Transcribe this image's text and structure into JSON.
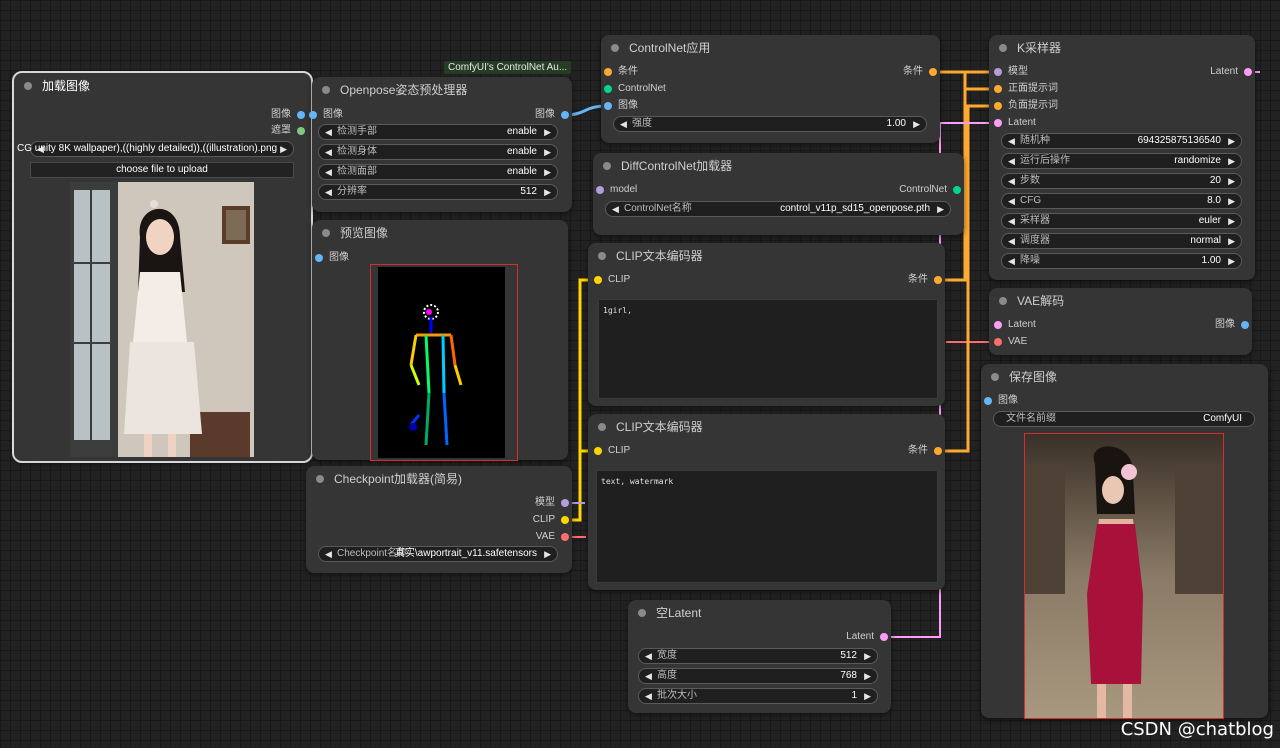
{
  "colors": {
    "image": "#64b5f6",
    "mask": "#81c784",
    "conditioning": "#ffa931",
    "control_net": "#00d78d",
    "model": "#b39ddb",
    "clip": "#ffd500",
    "vae": "#ff6e6e",
    "latent": "#ff9cf9",
    "frame_red": "#d32f2f"
  },
  "badge": "ComfyUI's ControlNet Au...",
  "load_image": {
    "title": "加载图像",
    "outputs": [
      "图像",
      "遮罩"
    ],
    "file_value": "CG unity 8K wallpaper),((highly detailed)),((illustration).png",
    "upload_label": "choose file to upload",
    "image_icon": "photo-girl-white-dress"
  },
  "openpose": {
    "title": "Openpose姿态预处理器",
    "input": "图像",
    "output": "图像",
    "widgets": [
      {
        "name": "检测手部",
        "value": "enable"
      },
      {
        "name": "检测身体",
        "value": "enable"
      },
      {
        "name": "检测面部",
        "value": "enable"
      },
      {
        "name": "分辨率",
        "value": "512"
      }
    ]
  },
  "preview": {
    "title": "预览图像",
    "input": "图像",
    "image_icon": "pose-skeleton"
  },
  "checkpoint": {
    "title": "Checkpoint加载器(简易)",
    "outputs": [
      "模型",
      "CLIP",
      "VAE"
    ],
    "widget": {
      "name": "Checkpoint名称",
      "value": "真实\\awportrait_v11.safetensors"
    }
  },
  "cn_apply": {
    "title": "ControlNet应用",
    "inputs": [
      "条件",
      "ControlNet",
      "图像"
    ],
    "output": "条件",
    "widget": {
      "name": "强度",
      "value": "1.00"
    }
  },
  "diff_cn": {
    "title": "DiffControlNet加载器",
    "input": "model",
    "output": "ControlNet",
    "widget": {
      "name": "ControlNet名称",
      "value": "control_v11p_sd15_openpose.pth"
    }
  },
  "clip_pos": {
    "title": "CLIP文本编码器",
    "input": "CLIP",
    "output": "条件",
    "text": "1girl,"
  },
  "clip_neg": {
    "title": "CLIP文本编码器",
    "input": "CLIP",
    "output": "条件",
    "text": "text, watermark"
  },
  "empty_latent": {
    "title": "空Latent",
    "output": "Latent",
    "widgets": [
      {
        "name": "宽度",
        "value": "512"
      },
      {
        "name": "高度",
        "value": "768"
      },
      {
        "name": "批次大小",
        "value": "1"
      }
    ]
  },
  "ksampler": {
    "title": "K采样器",
    "inputs": [
      "模型",
      "正面提示词",
      "负面提示词",
      "Latent"
    ],
    "output": "Latent",
    "widgets": [
      {
        "name": "随机种",
        "value": "694325875136540"
      },
      {
        "name": "运行后操作",
        "value": "randomize"
      },
      {
        "name": "步数",
        "value": "20"
      },
      {
        "name": "CFG",
        "value": "8.0"
      },
      {
        "name": "采样器",
        "value": "euler"
      },
      {
        "name": "调度器",
        "value": "normal"
      },
      {
        "name": "降噪",
        "value": "1.00"
      }
    ]
  },
  "vae_decode": {
    "title": "VAE解码",
    "inputs": [
      "Latent",
      "VAE"
    ],
    "output": "图像"
  },
  "save_image": {
    "title": "保存图像",
    "input": "图像",
    "widget": {
      "name": "文件名前缀",
      "value": "ComfyUI"
    },
    "image_icon": "photo-woman-red-dress"
  },
  "watermark": "CSDN @chatblog"
}
